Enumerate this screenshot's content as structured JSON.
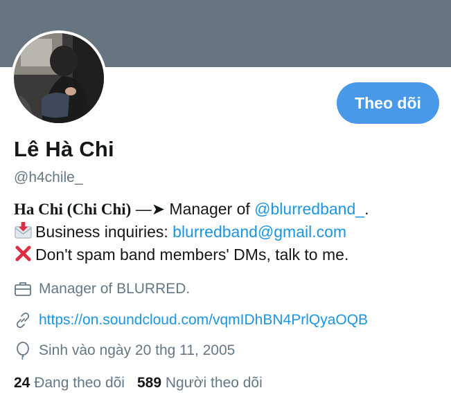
{
  "profile": {
    "name": "Lê Hà Chi",
    "handle": "@h4chile_",
    "follow_label": "Theo dõi"
  },
  "bio": {
    "line1_serif": "Ha Chi (Chi Chi)",
    "line1_arrow": "—➤",
    "line1_text": "Manager of",
    "line1_mention": "@blurredband_",
    "line1_end": ".",
    "line2_text": "Business inquiries:",
    "line2_email": "blurredband@gmail.com",
    "line3_text": "Don't spam band members' DMs, talk to me."
  },
  "meta": {
    "work": "Manager of BLURRED.",
    "url": "https://on.soundcloud.com/vqmIDhBN4PrlQyaOQB",
    "birthday": "Sinh vào ngày 20 thg 11, 2005"
  },
  "stats": {
    "following_count": "24",
    "following_label": "Đang theo dõi",
    "followers_count": "589",
    "followers_label": "Người theo dõi"
  },
  "icons": {
    "work": "briefcase-icon",
    "url": "link-icon",
    "birthday": "balloon-icon",
    "inbox": "envelope-arrow-icon",
    "cross": "cross-mark-icon"
  },
  "colors": {
    "banner": "#66757f",
    "accent": "#1b95e0",
    "button": "#4a99e9",
    "muted": "#657786",
    "cross": "#dd2e44"
  }
}
